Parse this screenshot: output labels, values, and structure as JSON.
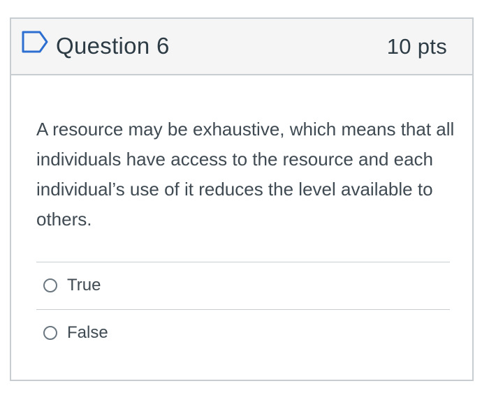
{
  "question": {
    "title": "Question 6",
    "points": "10 pts",
    "text": "A resource may be exhaustive, which means that all individuals have access to the resource and each individual’s use of it reduces the level available to others.",
    "flag_icon": "flag-outline-icon"
  },
  "answers": [
    {
      "label": "True",
      "selected": false
    },
    {
      "label": "False",
      "selected": false
    }
  ],
  "colors": {
    "header_bg": "#f5f5f5",
    "border": "#c7cdd1",
    "text": "#2d3b45",
    "flag": "#2d6fd0"
  }
}
